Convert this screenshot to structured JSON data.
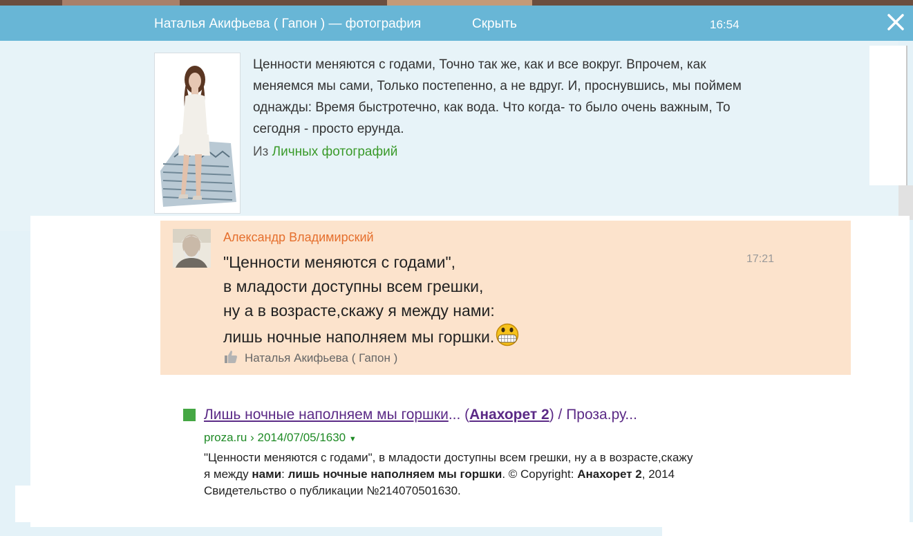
{
  "header": {
    "title": "Наталья Акифьева ( Гапон ) — фотография",
    "hide_label": "Скрыть",
    "time": "16:54",
    "close_icon": "close-icon"
  },
  "photo": {
    "description": "Ценности меняются с годами, Точно так же, как и все вокруг. Впрочем, как меняемся мы сами, Только постепенно, а не вдруг. И, проснувшись, мы поймем однажды: Время быстротечно, как вода. Что когда- то было очень важным, То сегодня - просто ерунда.",
    "from_prefix": "Из",
    "album_link": "Личных фотографий"
  },
  "comment": {
    "author": "Александр Владимирский",
    "time": "17:21",
    "lines": [
      "\"Ценности меняются с годами\",",
      "в младости доступны всем грешки,",
      "ну а в возрасте,скажу я между нами:",
      "лишь ночные наполняем мы горшки."
    ],
    "liked_by": "Наталья Акифьева ( Гапон )",
    "emoji_icon": "grin-emoji-icon",
    "like_icon": "thumbs-up-icon"
  },
  "search_result": {
    "title_part1": "Лишь ночные наполняем мы горшки",
    "title_part2": "... (",
    "title_part3": "Анахорет 2",
    "title_part4": ") / Проза.ру...",
    "url_domain": "proza.ru",
    "url_sep": "›",
    "url_path": "2014/07/05/1630",
    "snip_1": "\"Ценности меняются с годами\", в младости доступны всем грешки, ну а в возрасте,скажу я между ",
    "snip_b1": "нами",
    "snip_2": ": ",
    "snip_b2": "лишь ночные наполняем мы горшки",
    "snip_3": ". © Copyright: ",
    "snip_b3": "Анахорет 2",
    "snip_4": ", 2014 Свидетельство о публикации №214070501630."
  }
}
